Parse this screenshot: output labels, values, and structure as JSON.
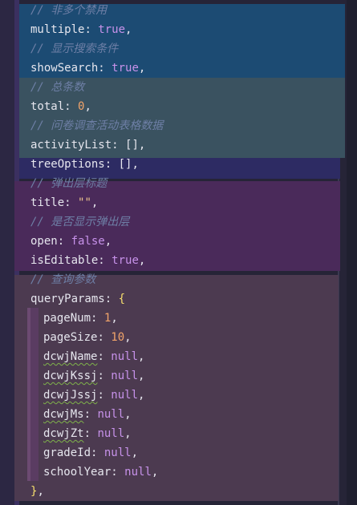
{
  "lines": [
    {
      "kind": "comment",
      "text": "// 非多个禁用"
    },
    {
      "kind": "prop",
      "key": "multiple",
      "sep": ": ",
      "value": "true",
      "vtype": "bool",
      "end": ","
    },
    {
      "kind": "comment",
      "text": "// 显示搜索条件"
    },
    {
      "kind": "prop",
      "key": "showSearch",
      "sep": ": ",
      "value": "true",
      "vtype": "bool",
      "end": ","
    },
    {
      "kind": "comment",
      "text": "// 总条数"
    },
    {
      "kind": "prop",
      "key": "total",
      "sep": ": ",
      "value": "0",
      "vtype": "num",
      "end": ","
    },
    {
      "kind": "comment",
      "text": "// 问卷调查活动表格数据"
    },
    {
      "kind": "prop",
      "key": "activityList",
      "sep": ": ",
      "value": "[]",
      "vtype": "punc",
      "end": ","
    },
    {
      "kind": "prop",
      "key": "treeOptions",
      "sep": ": ",
      "value": "[]",
      "vtype": "punc",
      "end": ","
    },
    {
      "kind": "comment",
      "text": "// 弹出层标题"
    },
    {
      "kind": "prop",
      "key": "title",
      "sep": ": ",
      "value": "\"\"",
      "vtype": "str",
      "end": ","
    },
    {
      "kind": "comment",
      "text": "// 是否显示弹出层"
    },
    {
      "kind": "prop",
      "key": "open",
      "sep": ": ",
      "value": "false",
      "vtype": "bool",
      "end": ","
    },
    {
      "kind": "prop",
      "key": "isEditable",
      "sep": ": ",
      "value": "true",
      "vtype": "bool",
      "end": ","
    },
    {
      "kind": "comment",
      "text": "// 查询参数"
    },
    {
      "kind": "prop",
      "key": "queryParams",
      "sep": ": ",
      "value": "{",
      "vtype": "br",
      "end": ""
    },
    {
      "kind": "prop",
      "key": "pageNum",
      "sep": ": ",
      "value": "1",
      "vtype": "num",
      "end": ",",
      "indent": true
    },
    {
      "kind": "prop",
      "key": "pageSize",
      "sep": ": ",
      "value": "10",
      "vtype": "num",
      "end": ",",
      "indent": true
    },
    {
      "kind": "prop",
      "key": "dcwjName",
      "sep": ": ",
      "value": "null",
      "vtype": "nul",
      "end": ",",
      "indent": true,
      "squiggle": true
    },
    {
      "kind": "prop",
      "key": "dcwjKssj",
      "sep": ": ",
      "value": "null",
      "vtype": "nul",
      "end": ",",
      "indent": true,
      "squiggle": true
    },
    {
      "kind": "prop",
      "key": "dcwjJssj",
      "sep": ": ",
      "value": "null",
      "vtype": "nul",
      "end": ",",
      "indent": true,
      "squiggle": true
    },
    {
      "kind": "prop",
      "key": "dcwjMs",
      "sep": ": ",
      "value": "null",
      "vtype": "nul",
      "end": ",",
      "indent": true,
      "squiggle": true
    },
    {
      "kind": "prop",
      "key": "dcwjZt",
      "sep": ": ",
      "value": "null",
      "vtype": "nul",
      "end": ",",
      "indent": true,
      "squiggle": true
    },
    {
      "kind": "prop",
      "key": "gradeId",
      "sep": ": ",
      "value": "null",
      "vtype": "nul",
      "end": ",",
      "indent": true
    },
    {
      "kind": "prop",
      "key": "schoolYear",
      "sep": ": ",
      "value": "null",
      "vtype": "nul",
      "end": ",",
      "indent": true
    },
    {
      "kind": "close",
      "text": "}",
      "end": ","
    }
  ],
  "colors": {
    "comment": "#6e7fa6",
    "keyword": "#c792ea",
    "number": "#f2a46a",
    "bracket": "#f7df6e"
  }
}
